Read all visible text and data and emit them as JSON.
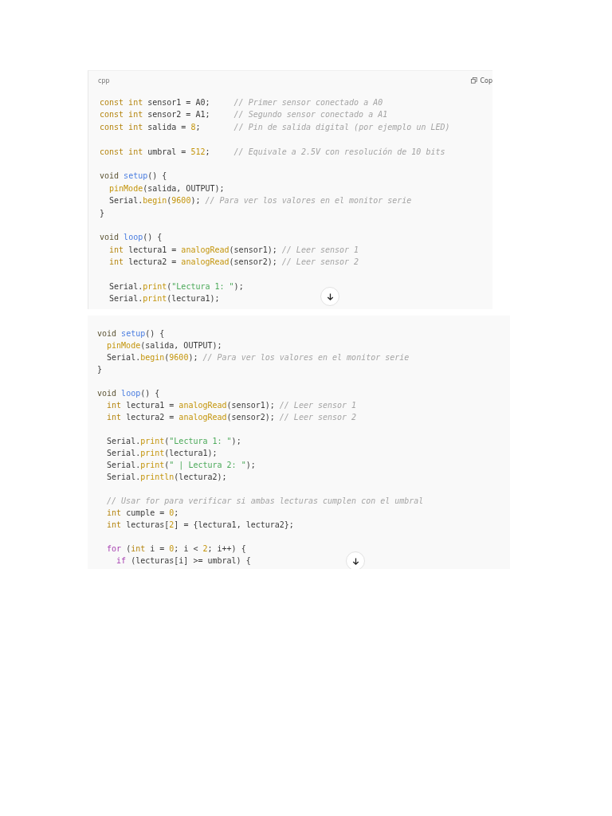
{
  "panels": [
    {
      "language": "cpp",
      "copy_label": "Cop",
      "blocks": [
        {
          "lines": [
            {
              "tokens": [
                {
                  "kind": "kw",
                  "text": "const int"
                },
                {
                  "kind": "p",
                  "text": " sensor1 = A0;     "
                },
                {
                  "kind": "com",
                  "text": "// Primer sensor conectado a A0"
                }
              ]
            },
            {
              "tokens": [
                {
                  "kind": "kw",
                  "text": "const int"
                },
                {
                  "kind": "p",
                  "text": " sensor2 = A1;     "
                },
                {
                  "kind": "com",
                  "text": "// Segundo sensor conectado a A1"
                }
              ]
            },
            {
              "tokens": [
                {
                  "kind": "kw",
                  "text": "const int"
                },
                {
                  "kind": "p",
                  "text": " salida = "
                },
                {
                  "kind": "num",
                  "text": "8"
                },
                {
                  "kind": "p",
                  "text": ";       "
                },
                {
                  "kind": "com",
                  "text": "// Pin de salida digital (por ejemplo un LED)"
                }
              ]
            }
          ]
        },
        {
          "lines": [
            {
              "tokens": [
                {
                  "kind": "kw",
                  "text": "const int"
                },
                {
                  "kind": "p",
                  "text": " umbral = "
                },
                {
                  "kind": "num",
                  "text": "512"
                },
                {
                  "kind": "p",
                  "text": ";     "
                },
                {
                  "kind": "com",
                  "text": "// Equivale a 2.5V con resolución de 10 bits"
                }
              ]
            }
          ]
        },
        {
          "lines": [
            {
              "tokens": [
                {
                  "kind": "void",
                  "text": "void"
                },
                {
                  "kind": "fn",
                  "text": " setup"
                },
                {
                  "kind": "p",
                  "text": "() {"
                }
              ]
            },
            {
              "tokens": [
                {
                  "kind": "call",
                  "text": "  pinMode"
                },
                {
                  "kind": "p",
                  "text": "(salida, OUTPUT);"
                }
              ]
            },
            {
              "tokens": [
                {
                  "kind": "p",
                  "text": "  Serial."
                },
                {
                  "kind": "call",
                  "text": "begin"
                },
                {
                  "kind": "p",
                  "text": "("
                },
                {
                  "kind": "num",
                  "text": "9600"
                },
                {
                  "kind": "p",
                  "text": "); "
                },
                {
                  "kind": "com",
                  "text": "// Para ver los valores en el monitor serie"
                }
              ]
            },
            {
              "tokens": [
                {
                  "kind": "p",
                  "text": "}"
                }
              ]
            }
          ]
        },
        {
          "lines": [
            {
              "tokens": [
                {
                  "kind": "void",
                  "text": "void"
                },
                {
                  "kind": "fn",
                  "text": " loop"
                },
                {
                  "kind": "p",
                  "text": "() {"
                }
              ]
            },
            {
              "tokens": [
                {
                  "kind": "kw",
                  "text": "  int"
                },
                {
                  "kind": "p",
                  "text": " lectura1 = "
                },
                {
                  "kind": "call",
                  "text": "analogRead"
                },
                {
                  "kind": "p",
                  "text": "(sensor1); "
                },
                {
                  "kind": "com",
                  "text": "// Leer sensor 1"
                }
              ]
            },
            {
              "tokens": [
                {
                  "kind": "kw",
                  "text": "  int"
                },
                {
                  "kind": "p",
                  "text": " lectura2 = "
                },
                {
                  "kind": "call",
                  "text": "analogRead"
                },
                {
                  "kind": "p",
                  "text": "(sensor2); "
                },
                {
                  "kind": "com",
                  "text": "// Leer sensor 2"
                }
              ]
            }
          ]
        },
        {
          "lines": [
            {
              "tokens": [
                {
                  "kind": "p",
                  "text": "  Serial."
                },
                {
                  "kind": "call",
                  "text": "print"
                },
                {
                  "kind": "p",
                  "text": "("
                },
                {
                  "kind": "str",
                  "text": "\"Lectura 1: \""
                },
                {
                  "kind": "p",
                  "text": ");"
                }
              ]
            },
            {
              "tokens": [
                {
                  "kind": "p",
                  "text": "  Serial."
                },
                {
                  "kind": "call",
                  "text": "print"
                },
                {
                  "kind": "p",
                  "text": "(lectura1);"
                }
              ]
            }
          ]
        }
      ]
    },
    {
      "blocks": [
        {
          "lines": [
            {
              "tokens": [
                {
                  "kind": "void",
                  "text": "void"
                },
                {
                  "kind": "fn",
                  "text": " setup"
                },
                {
                  "kind": "p",
                  "text": "() {"
                }
              ]
            },
            {
              "tokens": [
                {
                  "kind": "call",
                  "text": "  pinMode"
                },
                {
                  "kind": "p",
                  "text": "(salida, OUTPUT);"
                }
              ]
            },
            {
              "tokens": [
                {
                  "kind": "p",
                  "text": "  Serial."
                },
                {
                  "kind": "call",
                  "text": "begin"
                },
                {
                  "kind": "p",
                  "text": "("
                },
                {
                  "kind": "num",
                  "text": "9600"
                },
                {
                  "kind": "p",
                  "text": "); "
                },
                {
                  "kind": "com",
                  "text": "// Para ver los valores en el monitor serie"
                }
              ]
            },
            {
              "tokens": [
                {
                  "kind": "p",
                  "text": "}"
                }
              ]
            }
          ]
        },
        {
          "lines": [
            {
              "tokens": [
                {
                  "kind": "void",
                  "text": "void"
                },
                {
                  "kind": "fn",
                  "text": " loop"
                },
                {
                  "kind": "p",
                  "text": "() {"
                }
              ]
            },
            {
              "tokens": [
                {
                  "kind": "kw",
                  "text": "  int"
                },
                {
                  "kind": "p",
                  "text": " lectura1 = "
                },
                {
                  "kind": "call",
                  "text": "analogRead"
                },
                {
                  "kind": "p",
                  "text": "(sensor1); "
                },
                {
                  "kind": "com",
                  "text": "// Leer sensor 1"
                }
              ]
            },
            {
              "tokens": [
                {
                  "kind": "kw",
                  "text": "  int"
                },
                {
                  "kind": "p",
                  "text": " lectura2 = "
                },
                {
                  "kind": "call",
                  "text": "analogRead"
                },
                {
                  "kind": "p",
                  "text": "(sensor2); "
                },
                {
                  "kind": "com",
                  "text": "// Leer sensor 2"
                }
              ]
            }
          ]
        },
        {
          "lines": [
            {
              "tokens": [
                {
                  "kind": "p",
                  "text": "  Serial."
                },
                {
                  "kind": "call",
                  "text": "print"
                },
                {
                  "kind": "p",
                  "text": "("
                },
                {
                  "kind": "str",
                  "text": "\"Lectura 1: \""
                },
                {
                  "kind": "p",
                  "text": ");"
                }
              ]
            },
            {
              "tokens": [
                {
                  "kind": "p",
                  "text": "  Serial."
                },
                {
                  "kind": "call",
                  "text": "print"
                },
                {
                  "kind": "p",
                  "text": "(lectura1);"
                }
              ]
            },
            {
              "tokens": [
                {
                  "kind": "p",
                  "text": "  Serial."
                },
                {
                  "kind": "call",
                  "text": "print"
                },
                {
                  "kind": "p",
                  "text": "("
                },
                {
                  "kind": "str",
                  "text": "\" | Lectura 2: \""
                },
                {
                  "kind": "p",
                  "text": ");"
                }
              ]
            },
            {
              "tokens": [
                {
                  "kind": "p",
                  "text": "  Serial."
                },
                {
                  "kind": "call",
                  "text": "println"
                },
                {
                  "kind": "p",
                  "text": "(lectura2);"
                }
              ]
            }
          ]
        },
        {
          "lines": [
            {
              "tokens": [
                {
                  "kind": "com",
                  "text": "  // Usar for para verificar si ambas lecturas cumplen con el umbral"
                }
              ]
            },
            {
              "tokens": [
                {
                  "kind": "kw",
                  "text": "  int"
                },
                {
                  "kind": "p",
                  "text": " cumple = "
                },
                {
                  "kind": "num",
                  "text": "0"
                },
                {
                  "kind": "p",
                  "text": ";"
                }
              ]
            },
            {
              "tokens": [
                {
                  "kind": "kw",
                  "text": "  int"
                },
                {
                  "kind": "p",
                  "text": " lecturas["
                },
                {
                  "kind": "num",
                  "text": "2"
                },
                {
                  "kind": "p",
                  "text": "] = {lectura1, lectura2};"
                }
              ]
            }
          ]
        },
        {
          "lines": [
            {
              "tokens": [
                {
                  "kind": "ctl",
                  "text": "  for"
                },
                {
                  "kind": "p",
                  "text": " ("
                },
                {
                  "kind": "kw",
                  "text": "int"
                },
                {
                  "kind": "p",
                  "text": " i = "
                },
                {
                  "kind": "num",
                  "text": "0"
                },
                {
                  "kind": "p",
                  "text": "; i < "
                },
                {
                  "kind": "num",
                  "text": "2"
                },
                {
                  "kind": "p",
                  "text": "; i++) {"
                }
              ]
            },
            {
              "tokens": [
                {
                  "kind": "ctl",
                  "text": "    if"
                },
                {
                  "kind": "p",
                  "text": " (lecturas[i] >= umbral) {"
                }
              ]
            }
          ]
        }
      ]
    }
  ]
}
